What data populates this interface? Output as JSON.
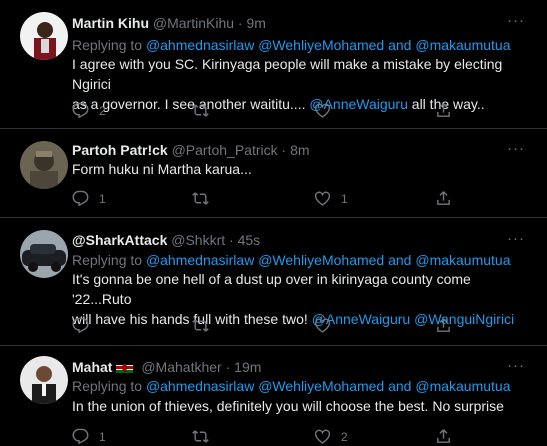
{
  "tweets": [
    {
      "name": "Martin Kihu",
      "handle": "@MartinKihu",
      "sep": " · ",
      "time": "9m",
      "replying_prefix": "Replying to ",
      "replying_users": [
        "@ahmednasirlaw",
        "@WehliyeMohamed",
        "@makaumutua"
      ],
      "replying_and": " and ",
      "text_line1": "I agree with you SC. Kirinyaga people will make a mistake by electing Ngirici",
      "text_line2_a": "as a governor. I see another waititu.... ",
      "text_line2_mention": "@AnneWaiguru",
      "text_line2_b": " all the way..",
      "reply_count": "2",
      "retweet_count": "",
      "like_count": ""
    },
    {
      "name": "Partoh Patr!ck",
      "handle": "@Partoh_Patrick",
      "sep": " · ",
      "time": "8m",
      "text": "Form huku ni Martha karua...",
      "reply_count": "1",
      "retweet_count": "",
      "like_count": "1"
    },
    {
      "name": "@SharkAttack",
      "handle": "@Shkkrt",
      "sep": " · ",
      "time": "45s",
      "replying_prefix": "Replying to ",
      "replying_users": [
        "@ahmednasirlaw",
        "@WehliyeMohamed",
        "@makaumutua"
      ],
      "replying_and": " and ",
      "text_line1": "It's gonna be one hell of a dust up over in kirinyaga county come '22...Ruto",
      "text_line2_a": "will have his hands full with these two! ",
      "text_line2_mention1": "@AnneWaiguru",
      "text_line2_space": " ",
      "text_line2_mention2": "@WanguiNgirici",
      "reply_count": "",
      "retweet_count": "",
      "like_count": ""
    },
    {
      "name": "Mahat",
      "handle": "@Mahatkher",
      "sep": " · ",
      "time": "19m",
      "replying_prefix": "Replying to ",
      "replying_users": [
        "@ahmednasirlaw",
        "@WehliyeMohamed",
        "@makaumutua"
      ],
      "replying_and": " and ",
      "text": "In the union of thieves, definitely you will choose the best. No surprise",
      "reply_count": "1",
      "retweet_count": "",
      "like_count": "2"
    }
  ],
  "more_label": "···",
  "colors": {
    "background": "#000000",
    "text": "#e7e9ea",
    "muted": "#71767b",
    "link": "#1d9bf0",
    "divider": "#2f3336"
  }
}
